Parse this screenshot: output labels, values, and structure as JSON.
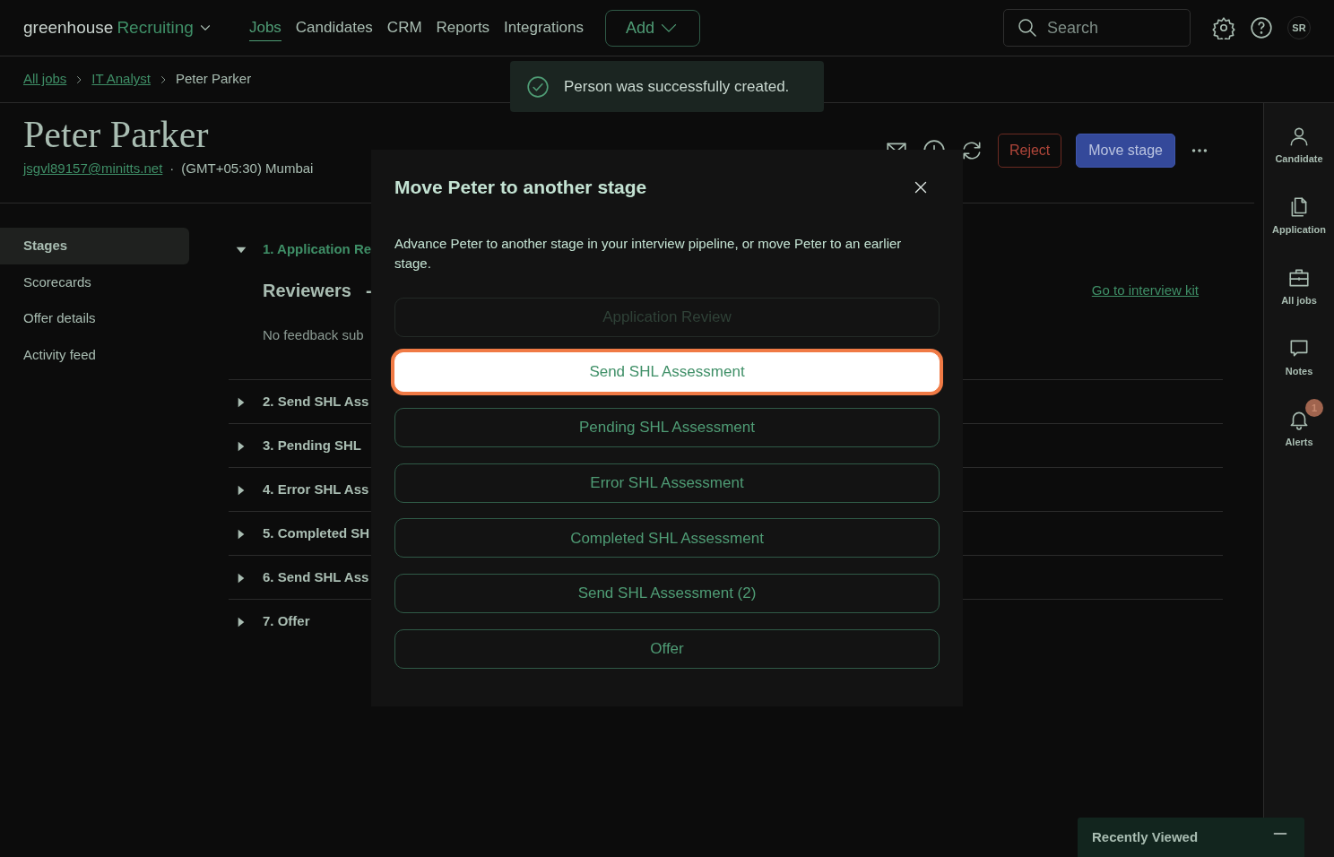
{
  "nav": {
    "logo": "greenhouse",
    "product": "Recruiting",
    "tabs": [
      {
        "label": "Jobs",
        "selected": true
      },
      {
        "label": "Candidates",
        "selected": false
      },
      {
        "label": "CRM",
        "selected": false
      },
      {
        "label": "Reports",
        "selected": false
      },
      {
        "label": "Integrations",
        "selected": false
      }
    ],
    "add_button": "Add",
    "search": {
      "placeholder": "Search"
    },
    "avatar": "SR"
  },
  "breadcrumb": [
    {
      "label": "All jobs",
      "kind": "link"
    },
    {
      "label": "IT Analyst",
      "kind": "link"
    },
    {
      "label": "Peter Parker",
      "kind": "current"
    }
  ],
  "toast": {
    "message": "Person was successfully created."
  },
  "candidate": {
    "name": "Peter Parker",
    "email": "jsgvl89157@minitts.net",
    "separator": "·",
    "timezone": "(GMT+05:30) Mumbai"
  },
  "actions": {
    "reject": "Reject",
    "move_stage": "Move stage"
  },
  "side_menu": [
    {
      "label": "Stages",
      "selected": true
    },
    {
      "label": "Scorecards",
      "selected": false
    },
    {
      "label": "Offer details",
      "selected": false
    },
    {
      "label": "Activity feed",
      "selected": false
    }
  ],
  "stages": [
    {
      "title": "1. Application Re",
      "expanded": true
    },
    {
      "title": "2. Send SHL Ass",
      "expanded": false
    },
    {
      "title": "3. Pending SHL",
      "expanded": false
    },
    {
      "title": "4. Error SHL Ass",
      "expanded": false
    },
    {
      "title": "5. Completed SH",
      "expanded": false
    },
    {
      "title": "6. Send SHL Ass",
      "expanded": false
    },
    {
      "title": "7. Offer",
      "expanded": false
    }
  ],
  "expanded_stage": {
    "reviewers": "Reviewers",
    "dash": "-",
    "feedback": "No feedback sub",
    "interview_kit_link": "Go to interview kit"
  },
  "rail": [
    {
      "label": "Candidate",
      "kind": "person"
    },
    {
      "label": "Application",
      "kind": "document"
    },
    {
      "label": "All jobs",
      "kind": "briefcase"
    },
    {
      "label": "Notes",
      "kind": "chat"
    },
    {
      "label": "Alerts",
      "kind": "bell",
      "badge": "1"
    }
  ],
  "modal": {
    "title": "Move Peter to another stage",
    "description": "Advance Peter to another stage in your interview pipeline, or move Peter to an earlier stage.",
    "options": [
      {
        "label": "Application Review",
        "disabled": true,
        "focused": false
      },
      {
        "label": "Send SHL Assessment",
        "disabled": false,
        "focused": true
      },
      {
        "label": "Pending SHL Assessment",
        "disabled": false,
        "focused": false
      },
      {
        "label": "Error SHL Assessment",
        "disabled": false,
        "focused": false
      },
      {
        "label": "Completed SHL Assessment",
        "disabled": false,
        "focused": false
      },
      {
        "label": "Send SHL Assessment (2)",
        "disabled": false,
        "focused": false
      },
      {
        "label": "Offer",
        "disabled": false,
        "focused": false
      }
    ]
  },
  "recently_viewed": {
    "title": "Recently Viewed"
  }
}
